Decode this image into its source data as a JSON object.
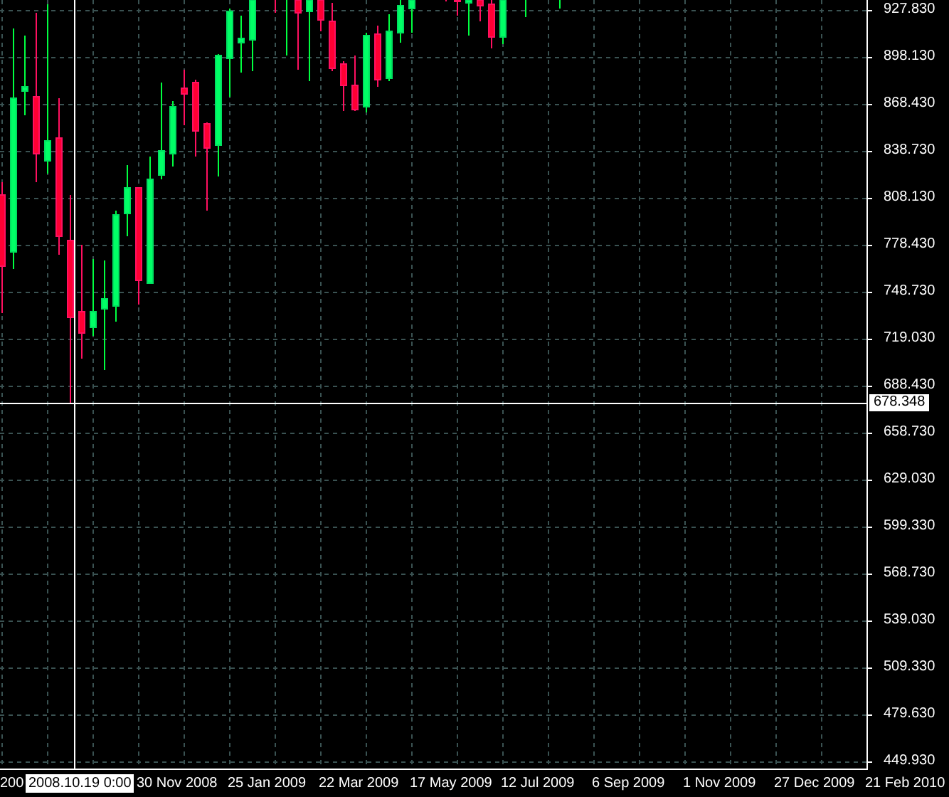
{
  "price_axis": {
    "labels": [
      "927.830",
      "898.130",
      "868.430",
      "838.730",
      "808.130",
      "778.430",
      "748.730",
      "719.030",
      "688.430",
      "658.730",
      "629.030",
      "599.330",
      "568.730",
      "539.030",
      "509.330",
      "479.630",
      "449.930"
    ]
  },
  "time_axis": {
    "labels": [
      "200",
      "30 Nov 2008",
      "25 Jan 2009",
      "22 Mar 2009",
      "17 May 2009",
      "12 Jul 2009",
      "6 Sep 2009",
      "1 Nov 2009",
      "27 Dec 2009",
      "21 Feb 2010"
    ]
  },
  "crosshair": {
    "price": "678.348",
    "time": "2008.10.19 0:00"
  }
}
